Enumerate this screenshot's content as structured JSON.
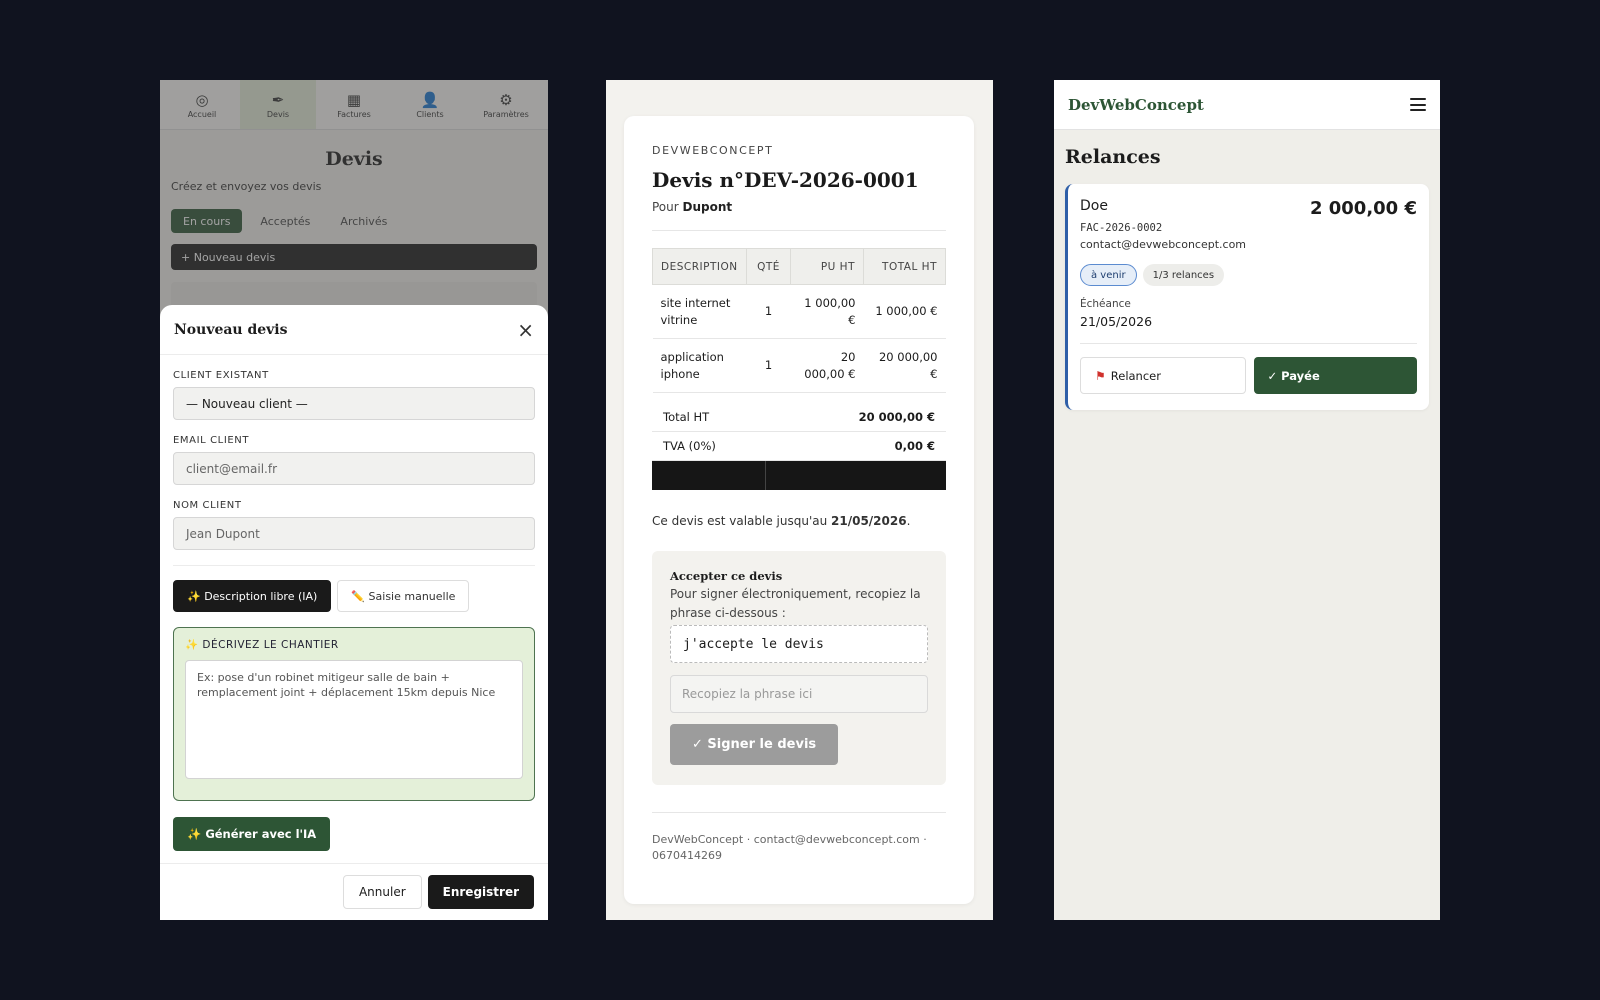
{
  "devis_app": {
    "nav": [
      {
        "icon": "◎",
        "label": "Accueil"
      },
      {
        "icon": "✒",
        "label": "Devis"
      },
      {
        "icon": "▦",
        "label": "Factures"
      },
      {
        "icon": "👤",
        "label": "Clients"
      },
      {
        "icon": "⚙",
        "label": "Paramètres"
      }
    ],
    "page_title": "Devis",
    "subtitle": "Créez et envoyez vos devis",
    "filters": [
      "En cours",
      "Acceptés",
      "Archivés"
    ],
    "new_button": "+ Nouveau devis",
    "modal": {
      "title": "Nouveau devis",
      "close_icon": "×",
      "client_label": "CLIENT EXISTANT",
      "client_value": "— Nouveau client —",
      "email_label": "EMAIL CLIENT",
      "email_placeholder": "client@email.fr",
      "name_label": "NOM CLIENT",
      "name_placeholder": "Jean Dupont",
      "mode_ai": "✨ Description libre (IA)",
      "mode_manual": "✏️ Saisie manuelle",
      "describe_label": "✨ DÉCRIVEZ LE CHANTIER",
      "describe_placeholder": "Ex: pose d'un robinet mitigeur salle de bain + remplacement joint + déplacement 15km depuis Nice",
      "generate": "✨ Générer avec l'IA",
      "cancel": "Annuler",
      "save": "Enregistrer"
    }
  },
  "quote": {
    "brand": "DEVWEBCONCEPT",
    "title": "Devis n°DEV-2026-0001",
    "for_prefix": "Pour ",
    "client": "Dupont",
    "columns": [
      "DESCRIPTION",
      "QTÉ",
      "PU HT",
      "TOTAL HT"
    ],
    "rows": [
      {
        "description": "site internet vitrine",
        "qty": "1",
        "unit": "1 000,00 €",
        "total": "1 000,00 €"
      },
      {
        "description": "application iphone",
        "qty": "1",
        "unit": "20 000,00 €",
        "total": "20 000,00 €"
      }
    ],
    "total_ht_label": "Total HT",
    "total_ht": "20 000,00 €",
    "tva_label": "TVA (0%)",
    "tva": "0,00 €",
    "validity_prefix": "Ce devis est valable jusqu'au ",
    "validity_date": "21/05/2026",
    "validity_suffix": ".",
    "accept_title": "Accepter ce devis",
    "accept_desc": "Pour signer électroniquement, recopiez la phrase ci-dessous :",
    "phrase": "j'accepte le devis",
    "sign_placeholder": "Recopiez la phrase ici",
    "sign_button": "✓ Signer le devis",
    "footer": "DevWebConcept · contact@devwebconcept.com · 0670414269"
  },
  "relances": {
    "logo": "DevWebConcept",
    "title": "Relances",
    "card": {
      "name": "Doe",
      "amount": "2 000,00 €",
      "ref": "FAC-2026-0002",
      "email": "contact@devwebconcept.com",
      "badge_status": "à venir",
      "badge_count": "1/3 relances",
      "due_label": "Échéance",
      "due_date": "21/05/2026",
      "relancer": "Relancer",
      "paid": "✓ Payée"
    }
  }
}
